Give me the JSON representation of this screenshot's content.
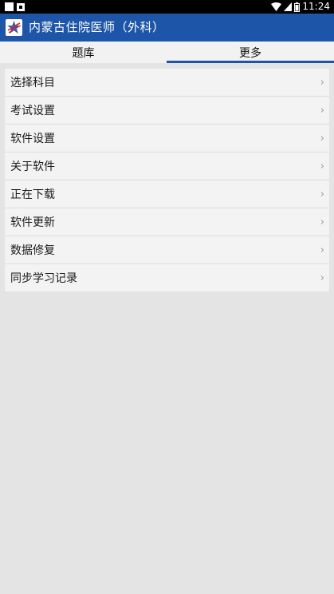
{
  "status_bar": {
    "time": "11:24",
    "icons": [
      "notification-square-icon",
      "notification-a-icon",
      "wifi-icon",
      "signal-icon",
      "battery-icon"
    ]
  },
  "app_bar": {
    "title": "内蒙古住院医师（外科）",
    "background_color": "#1d56a8",
    "logo_icon": "star-logo-icon"
  },
  "tabs": [
    {
      "label": "题库",
      "selected": false
    },
    {
      "label": "更多",
      "selected": true
    }
  ],
  "menu": {
    "items": [
      {
        "label": "选择科目"
      },
      {
        "label": "考试设置"
      },
      {
        "label": "软件设置"
      },
      {
        "label": "关于软件"
      },
      {
        "label": "正在下载"
      },
      {
        "label": "软件更新"
      },
      {
        "label": "数据修复"
      },
      {
        "label": "同步学习记录"
      }
    ],
    "chevron": "›"
  }
}
